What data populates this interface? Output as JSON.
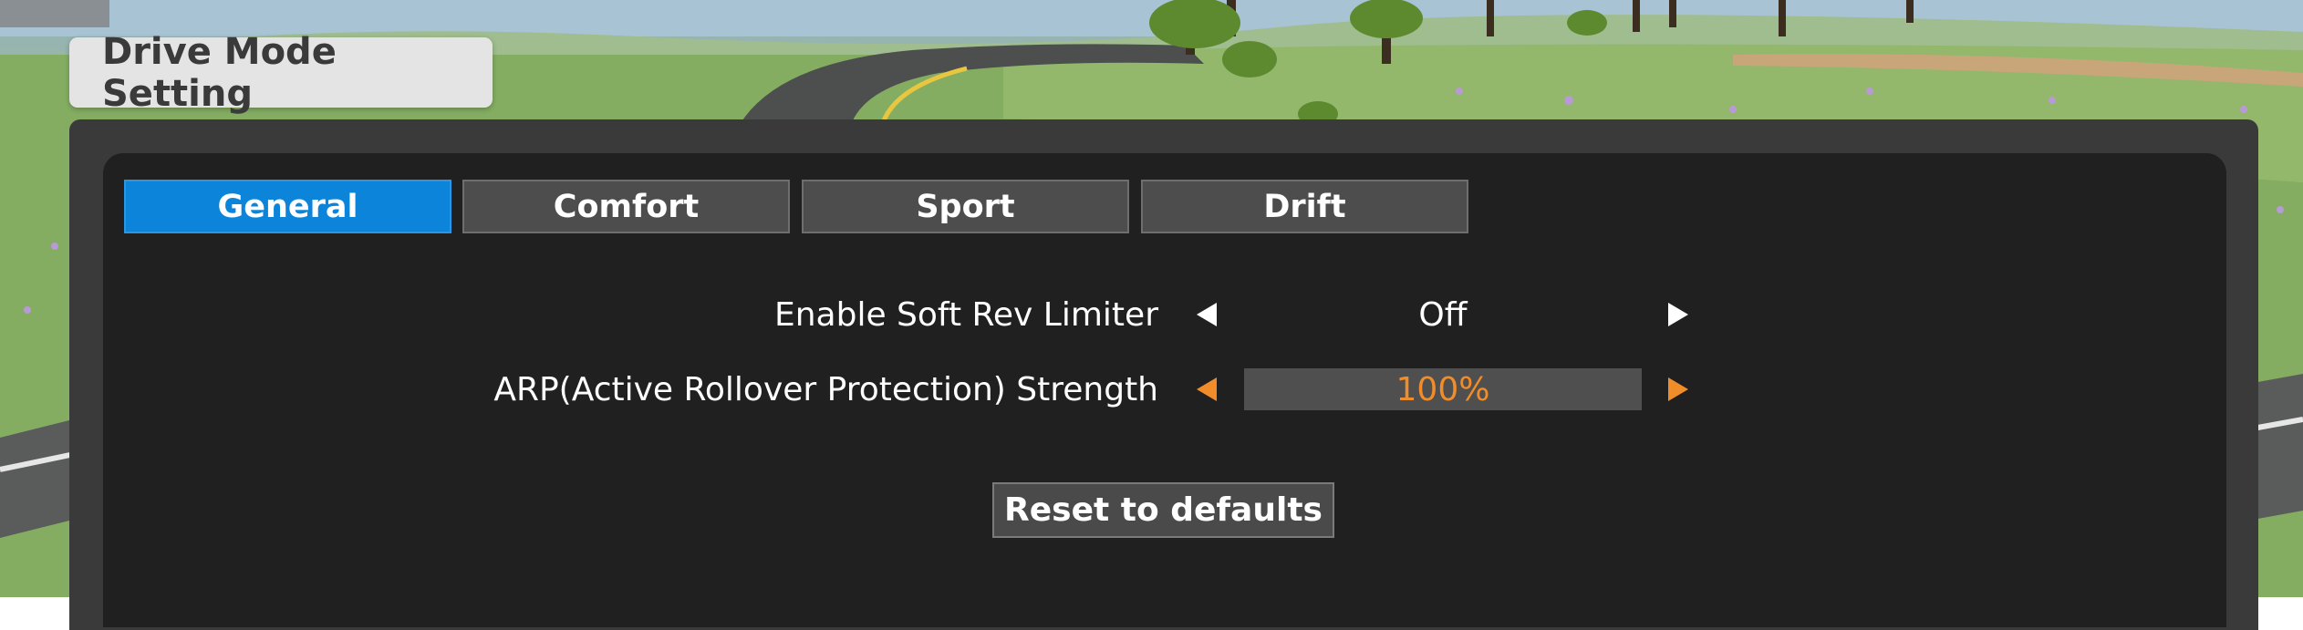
{
  "window": {
    "title": "Drive Mode Setting"
  },
  "tabs": [
    {
      "label": "General",
      "active": true
    },
    {
      "label": "Comfort",
      "active": false
    },
    {
      "label": "Sport",
      "active": false
    },
    {
      "label": "Drift",
      "active": false
    }
  ],
  "settings": [
    {
      "label": "Enable Soft Rev Limiter",
      "value": "Off",
      "selected": false
    },
    {
      "label": "ARP(Active Rollover Protection) Strength",
      "value": "100%",
      "selected": true
    }
  ],
  "actions": {
    "reset_label": "Reset to defaults"
  },
  "colors": {
    "accent_tab": "#0c84da",
    "selected_value": "#f08c2a",
    "panel_bg": "#202020",
    "panel_frame": "#3a3a3a"
  },
  "icons": {
    "left_arrow": "triangle-left-icon",
    "right_arrow": "triangle-right-icon"
  }
}
